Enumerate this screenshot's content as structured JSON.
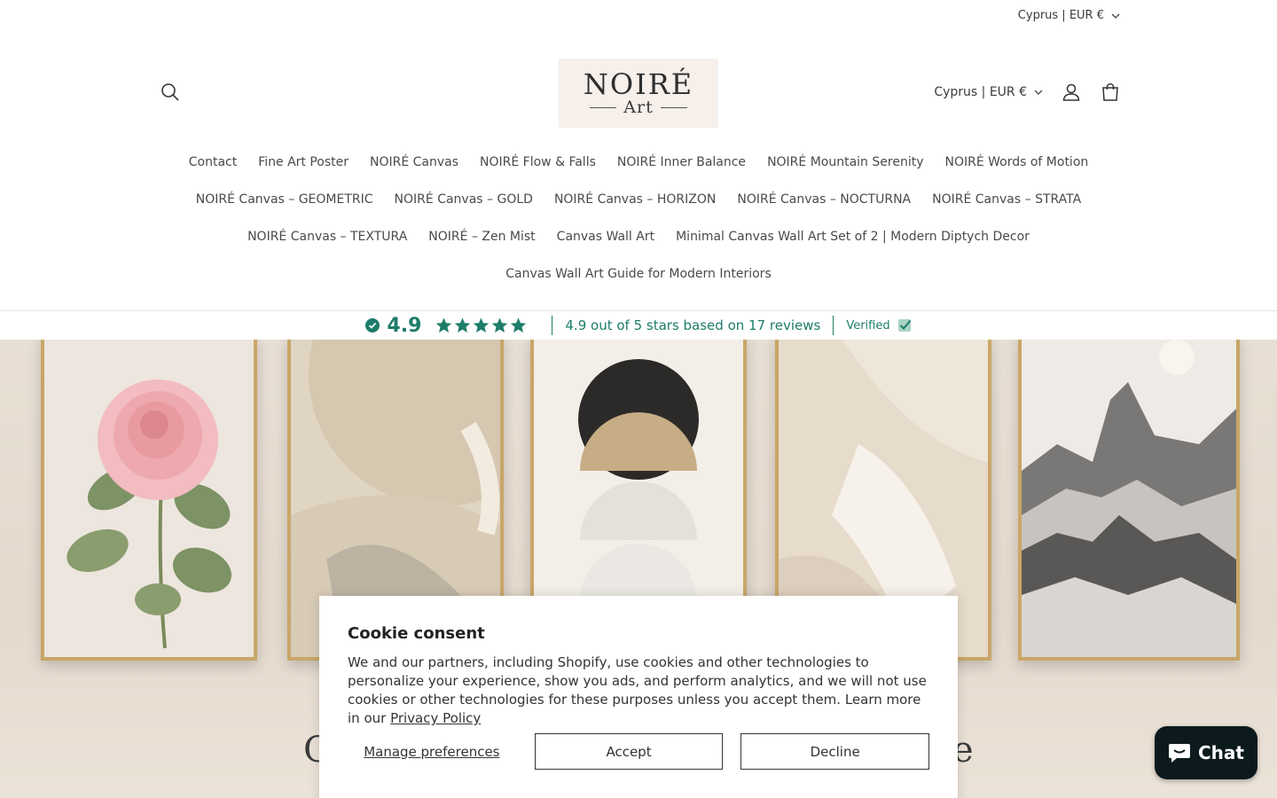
{
  "utility": {
    "country_label": "Cyprus | EUR €"
  },
  "header": {
    "logo_main": "NOIRÉ",
    "logo_sub": "Art",
    "country_label": "Cyprus | EUR €"
  },
  "nav": {
    "row1": [
      "Contact",
      "Fine Art Poster",
      "NOIRÉ Canvas",
      "NOIRÉ Flow & Falls",
      "NOIRÉ Inner Balance",
      "NOIRÉ Mountain Serenity",
      "NOIRÉ Words of Motion"
    ],
    "row2": [
      "NOIRÉ Canvas – GEOMETRIC",
      "NOIRÉ Canvas – GOLD",
      "NOIRÉ Canvas – HORIZON",
      "NOIRÉ Canvas – NOCTURNA",
      "NOIRÉ Canvas – STRATA"
    ],
    "row3": [
      "NOIRÉ Canvas – TEXTURA",
      "NOIRÉ – Zen Mist",
      "Canvas Wall Art",
      "Minimal Canvas Wall Art Set of 2 | Modern Diptych Decor"
    ],
    "row4": [
      "Canvas Wall Art Guide for Modern Interiors"
    ]
  },
  "reviews": {
    "score": "4.9",
    "stars": 5,
    "summary": "4.9 out of 5 stars based on 17 reviews",
    "verified_label": "Verified"
  },
  "hero": {
    "headline_left": "C",
    "headline_right": "e"
  },
  "cookie": {
    "title": "Cookie consent",
    "body": "We and our partners, including Shopify, use cookies and other technologies to personalize your experience, show you ads, and perform analytics, and we will not use cookies or other technologies for these purposes unless you accept them. Learn more in our ",
    "privacy_link": "Privacy Policy",
    "manage_label": "Manage preferences",
    "accept_label": "Accept",
    "decline_label": "Decline"
  },
  "chat": {
    "label": "Chat"
  },
  "colors": {
    "accent": "#1d7c6a",
    "chat_bg": "#0c1a1d",
    "frame_gold": "#c9a668"
  }
}
